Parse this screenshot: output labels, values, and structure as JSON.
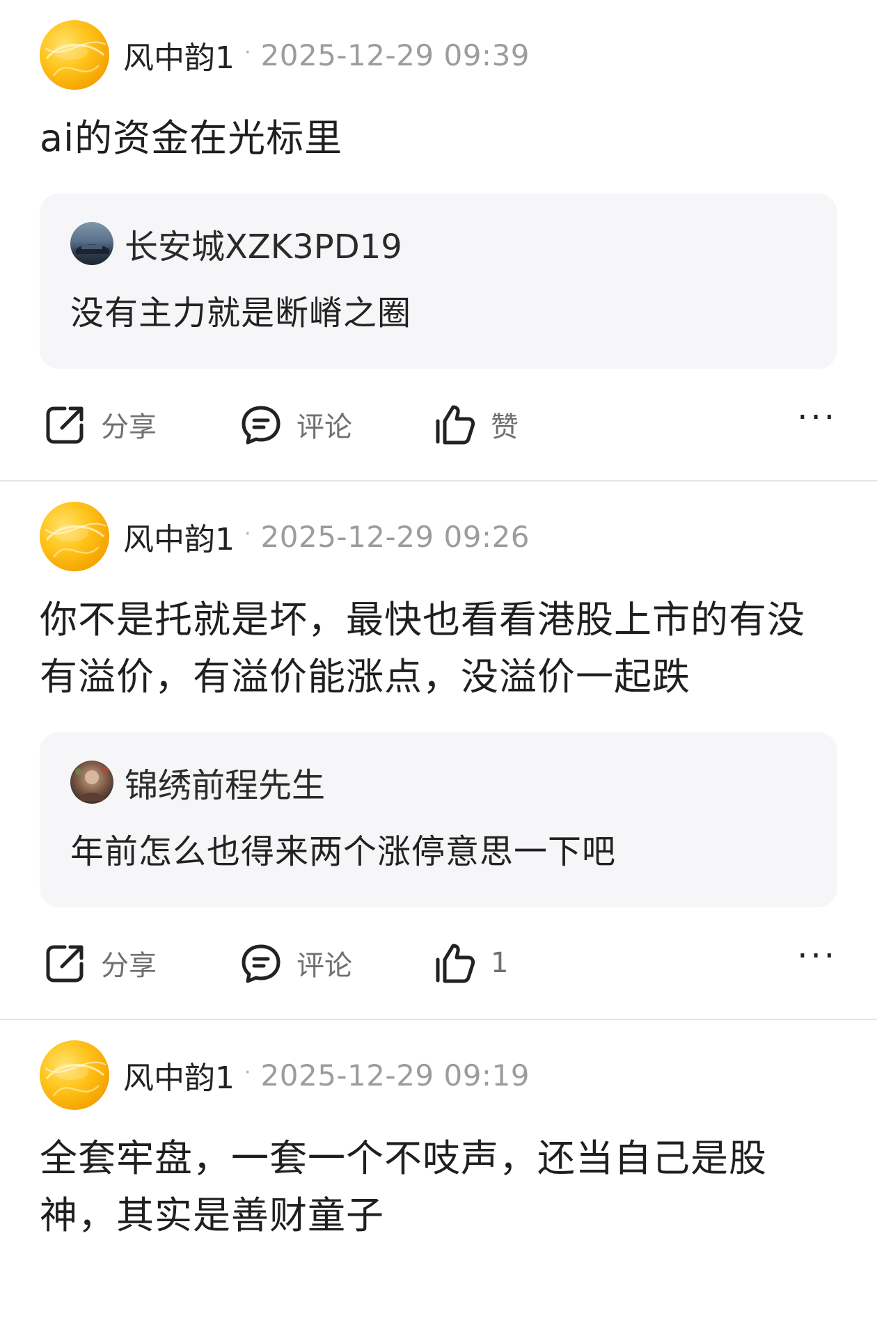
{
  "posts": [
    {
      "author": "风中韵1",
      "separator": "·",
      "timestamp": "2025-12-29 09:39",
      "body": "ai的资金在光标里",
      "quote": {
        "author": "长安城XZK3PD19",
        "text": "没有主力就是断嵴之圈"
      },
      "actions": {
        "share": "分享",
        "comment": "评论",
        "like": "赞",
        "more": "···"
      }
    },
    {
      "author": "风中韵1",
      "separator": "·",
      "timestamp": "2025-12-29 09:26",
      "body": "你不是托就是坏，最快也看看港股上市的有没有溢价，有溢价能涨点，没溢价一起跌",
      "quote": {
        "author": "锦绣前程先生",
        "text": "年前怎么也得来两个涨停意思一下吧"
      },
      "actions": {
        "share": "分享",
        "comment": "评论",
        "like": "1",
        "more": "···"
      }
    },
    {
      "author": "风中韵1",
      "separator": "·",
      "timestamp": "2025-12-29 09:19",
      "body": "全套牢盘，一套一个不吱声，还当自己是股神，其实是善财童子"
    }
  ],
  "icons": {
    "share": "share-icon",
    "comment": "comment-icon",
    "like": "thumbs-up-icon",
    "more": "more-dots-icon"
  },
  "colors": {
    "quote_background": "#f6f6f8",
    "meta_text": "#9c9c9c",
    "action_text": "#707070",
    "avatar_gold": "#ffc31a"
  }
}
